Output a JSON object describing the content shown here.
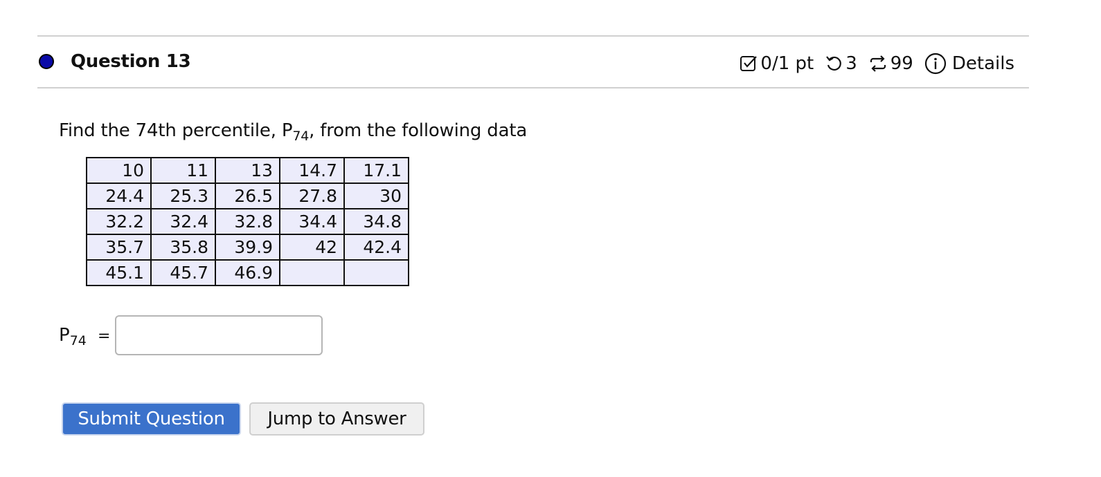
{
  "question": {
    "title": "Question 13",
    "status_dot_color": "#0a0aa8"
  },
  "meta": {
    "score": "0/1 pt",
    "retries": "3",
    "attempts": "99",
    "details_label": "Details",
    "icons": [
      "checkbox-icon",
      "undo-icon",
      "repeat-icon",
      "info-icon"
    ]
  },
  "prompt": {
    "before": "Find the 74th percentile, P",
    "subscript": "74",
    "after": ",  from the following data"
  },
  "data_table": {
    "rows": [
      [
        "10",
        "11",
        "13",
        "14.7",
        "17.1"
      ],
      [
        "24.4",
        "25.3",
        "26.5",
        "27.8",
        "30"
      ],
      [
        "32.2",
        "32.4",
        "32.8",
        "34.4",
        "34.8"
      ],
      [
        "35.7",
        "35.8",
        "39.9",
        "42",
        "42.4"
      ],
      [
        "45.1",
        "45.7",
        "46.9",
        "",
        ""
      ]
    ]
  },
  "answer": {
    "label": "P",
    "label_sub": "74",
    "equals": "=",
    "value": "",
    "placeholder": ""
  },
  "buttons": {
    "submit": "Submit Question",
    "jump": "Jump to Answer"
  }
}
